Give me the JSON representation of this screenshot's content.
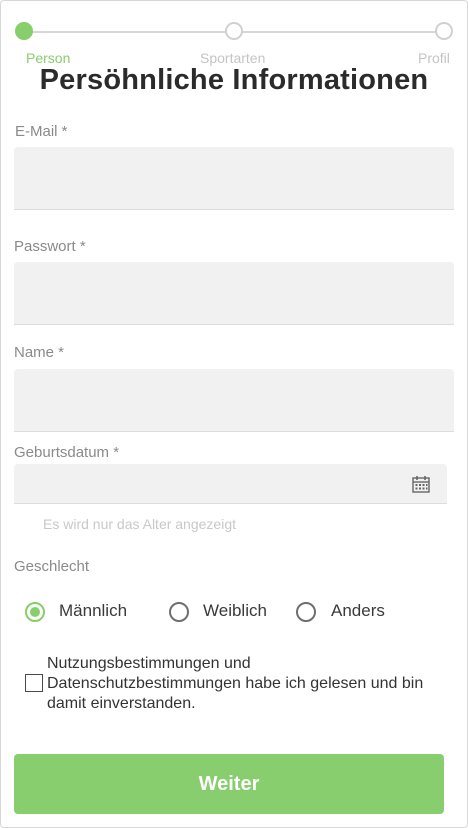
{
  "stepper": {
    "steps": [
      {
        "label": "Person",
        "active": true
      },
      {
        "label": "Sportarten",
        "active": false
      },
      {
        "label": "Profil",
        "active": false
      }
    ]
  },
  "title": "Persöhnliche Informationen",
  "fields": {
    "email": {
      "label": "E-Mail *",
      "value": ""
    },
    "password": {
      "label": "Passwort *",
      "value": ""
    },
    "name": {
      "label": "Name *",
      "value": ""
    },
    "birthdate": {
      "label": "Geburtsdatum *",
      "value": "",
      "hint": "Es wird nur das Alter angezeigt",
      "icon": "calendar-icon"
    }
  },
  "gender": {
    "label": "Geschlecht",
    "options": [
      {
        "label": "Männlich",
        "checked": true
      },
      {
        "label": "Weiblich",
        "checked": false
      },
      {
        "label": "Anders",
        "checked": false
      }
    ]
  },
  "terms": {
    "text": "Nutzungsbestimmungen und Datenschutzbestimmungen habe ich gelesen und bin damit einverstanden.",
    "checked": false
  },
  "submit_label": "Weiter",
  "colors": {
    "accent": "#86cf6a",
    "input_bg": "#f1f1f1",
    "label": "#8a8a8a"
  }
}
